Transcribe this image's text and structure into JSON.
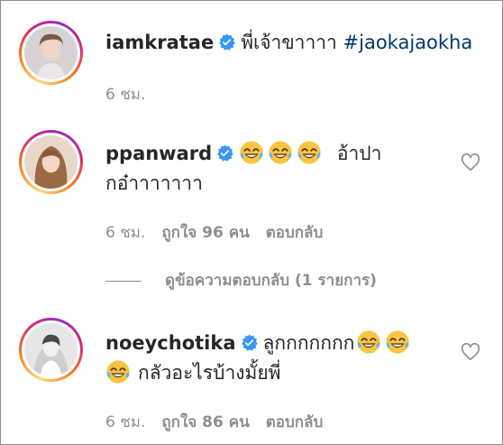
{
  "comments": [
    {
      "username": "iamkratae",
      "text": "พี่เจ้าขาาาา",
      "hashtag": "#jaokajaokha",
      "time": "6 ชม."
    },
    {
      "username": "ppanward",
      "text_after_emoji": "อ้าปา",
      "text_line2": "กอ๋าาาาาาา",
      "time": "6 ชม.",
      "likes": "ถูกใจ 96 คน",
      "reply": "ตอบกลับ",
      "emoji_count": 3
    },
    {
      "username": "noeychotika",
      "text": "ลูกกกกกกก",
      "text_line2": "กลัวอะไรบ้างมั้ยพี่",
      "time": "6 ชม.",
      "likes": "ถูกใจ 86 คน",
      "reply": "ตอบกลับ"
    }
  ],
  "view_replies": "ดูข้อความตอบกลับ (1 รายการ)",
  "colors": {
    "text": "#262626",
    "muted": "#8e8e8e",
    "hashtag": "#00376b",
    "verified": "#3897f0",
    "emoji": "#f7c543"
  },
  "icons": {
    "verified": "verified-badge-icon",
    "emoji": "face-with-tears-of-joy-emoji",
    "like": "heart-icon"
  }
}
